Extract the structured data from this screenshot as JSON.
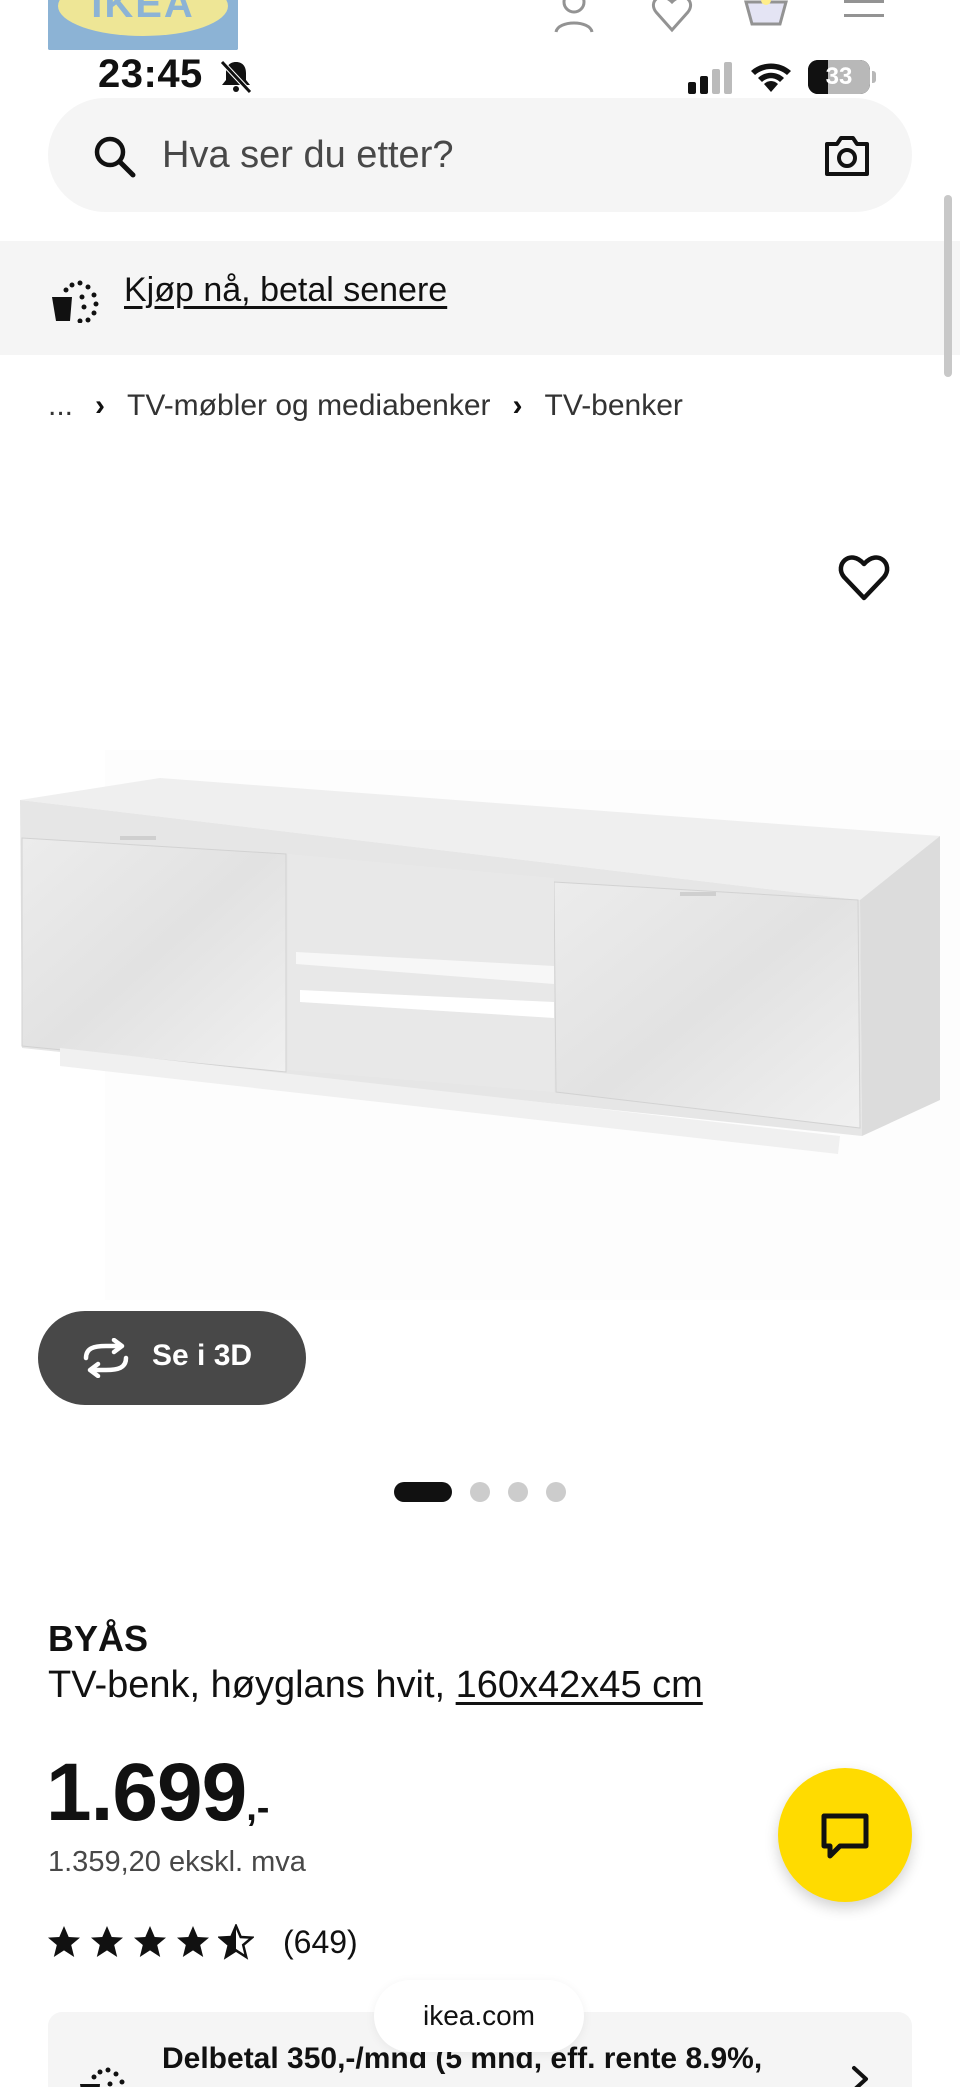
{
  "header": {
    "logo_text": "IKEA",
    "icons": [
      "person-icon",
      "heart-icon",
      "basket-icon",
      "hamburger-menu-icon"
    ]
  },
  "status_bar": {
    "time": "23:45",
    "battery_level": "33",
    "icons": [
      "silent-bell-icon",
      "signal-icon",
      "wifi-icon",
      "battery-icon"
    ]
  },
  "search": {
    "placeholder": "Hva ser du etter?",
    "value": ""
  },
  "promo": {
    "label": "Kjøp nå, betal senere"
  },
  "breadcrumb": {
    "ellipsis": "...",
    "items": [
      "TV-møbler og mediabenker",
      "TV-benker"
    ]
  },
  "gallery": {
    "view_3d_label": "Se i 3D",
    "image_count": 4,
    "active_index": 0
  },
  "product": {
    "name": "BYÅS",
    "description_prefix": "TV-benk, høyglans hvit,",
    "dimensions": "160x42x45 cm",
    "price_main": "1.699",
    "price_suffix": ",-",
    "price_excl_vat": "1.359,20 ekskl. mva",
    "rating_value": 4.5,
    "rating_count": "(649)"
  },
  "financing": {
    "text": "Delbetal 350,-/mnd (5 mnd, eff. rente 8.9%,"
  },
  "browser": {
    "url": "ikea.com"
  },
  "colors": {
    "ikea_blue": "#0058a3",
    "ikea_yellow": "#ffdb00",
    "pill_dark": "#484848",
    "surface_grey": "#f5f5f5"
  }
}
